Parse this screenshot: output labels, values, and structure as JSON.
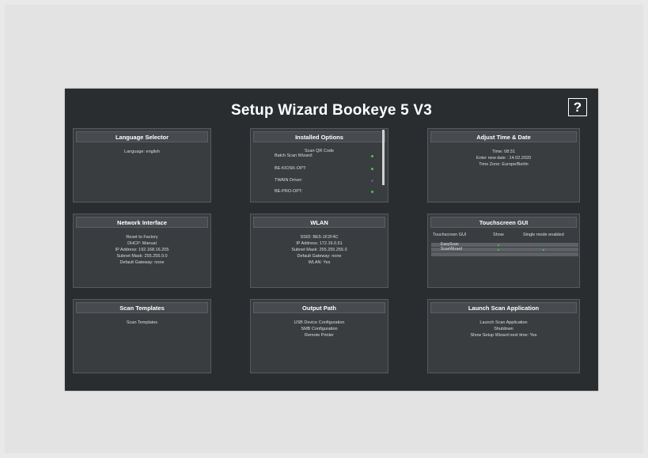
{
  "title": "Setup Wizard Bookeye 5 V3",
  "help_label": "?",
  "colors": {
    "background": "#2a2d30",
    "panel": "#3a3d40",
    "status_on": "#3fd13f"
  },
  "panels": {
    "language": {
      "header": "Language Selector",
      "lines": [
        "Language: english"
      ]
    },
    "installed": {
      "header": "Installed Options",
      "scan_qr": "Scan QR Code",
      "options": [
        {
          "label": "Batch Scan Wizard:",
          "enabled": true
        },
        {
          "label": "BE-KIOSK-OPT:",
          "enabled": true
        },
        {
          "label": "TWAIN Driver:",
          "enabled": false
        },
        {
          "label": "BE-PRO-OPT:",
          "enabled": true
        }
      ]
    },
    "time": {
      "header": "Adjust Time & Date",
      "lines": [
        "Time: 08:31",
        "Enter new date : 14.02.2020",
        "Time Zone: Europe/Berlin"
      ]
    },
    "network": {
      "header": "Network Interface",
      "lines": [
        "Reset to Factory",
        "DHCP: Manual",
        "IP Address: 192.168.16.205",
        "Subnet Mask: 255.255.0.0",
        "Default Gateway: none"
      ]
    },
    "wlan": {
      "header": "WLAN",
      "lines": [
        "SSID: BE5-1F2F4C",
        "IP Address: 172.16.0.51",
        "Subnet Mask: 255.255.255.0",
        "Default Gateway: none",
        "WLAN: Yes"
      ]
    },
    "touch": {
      "header": "Touchscreen GUI",
      "col_gui": "Touchscreen GUI",
      "col_show": "Show",
      "col_single": "Single mode enabled",
      "rows": [
        {
          "name": "EasyScan",
          "show": true,
          "single": false
        },
        {
          "name": "ScanWizard",
          "show": true,
          "single": true
        },
        {
          "name": "",
          "show": false,
          "single": false
        }
      ]
    },
    "templates": {
      "header": "Scan Templates",
      "lines": [
        "Scan Templates"
      ]
    },
    "output": {
      "header": "Output Path",
      "lines": [
        "USB Device Configuration",
        "SMB Configuration",
        "Remote Printer"
      ]
    },
    "launch": {
      "header": "Launch Scan Application",
      "lines": [
        "Launch Scan Application",
        "Shutdown",
        "Show Setup Wizard next time: Yes"
      ]
    }
  }
}
